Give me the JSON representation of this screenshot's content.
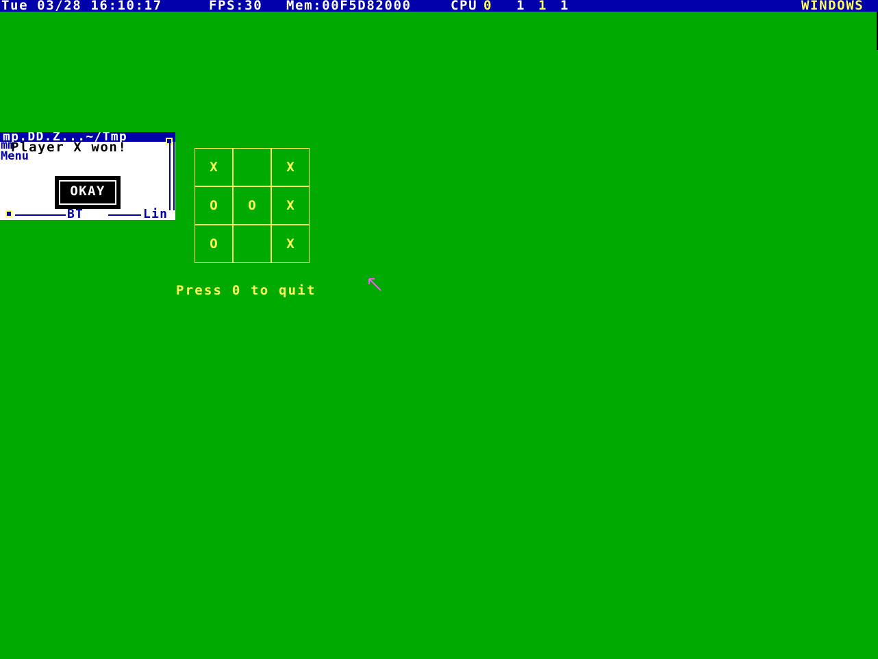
{
  "status_bar": {
    "datetime": "Tue 03/28 16:10:17",
    "fps": "FPS:30",
    "mem": "Mem:00F5D82000",
    "cpu_label": "CPU",
    "cpu0": "0",
    "cpu1": "1",
    "cpu2": "1",
    "cpu3": "1",
    "mode": "WINDOWS"
  },
  "popup": {
    "title": "mp.DD.Z...~/Tmp",
    "message": "Player X won!",
    "menu_label": "mm\nMenu",
    "button_label": "OKAY",
    "bottom_left": "BT",
    "bottom_right": "Lin"
  },
  "board": {
    "cells": [
      {
        "mark": "X"
      },
      {
        "mark": ""
      },
      {
        "mark": "X"
      },
      {
        "mark": "O"
      },
      {
        "mark": "O"
      },
      {
        "mark": "X"
      },
      {
        "mark": "O"
      },
      {
        "mark": ""
      },
      {
        "mark": "X"
      }
    ]
  },
  "quit_message": "Press 0 to quit",
  "colors": {
    "desktop": "#00aa00",
    "bar": "#0000aa",
    "highlight": "#ffff55",
    "cursor": "#ff55ff"
  },
  "icons": {
    "mouse_cursor": "arrow-pointer-icon"
  }
}
